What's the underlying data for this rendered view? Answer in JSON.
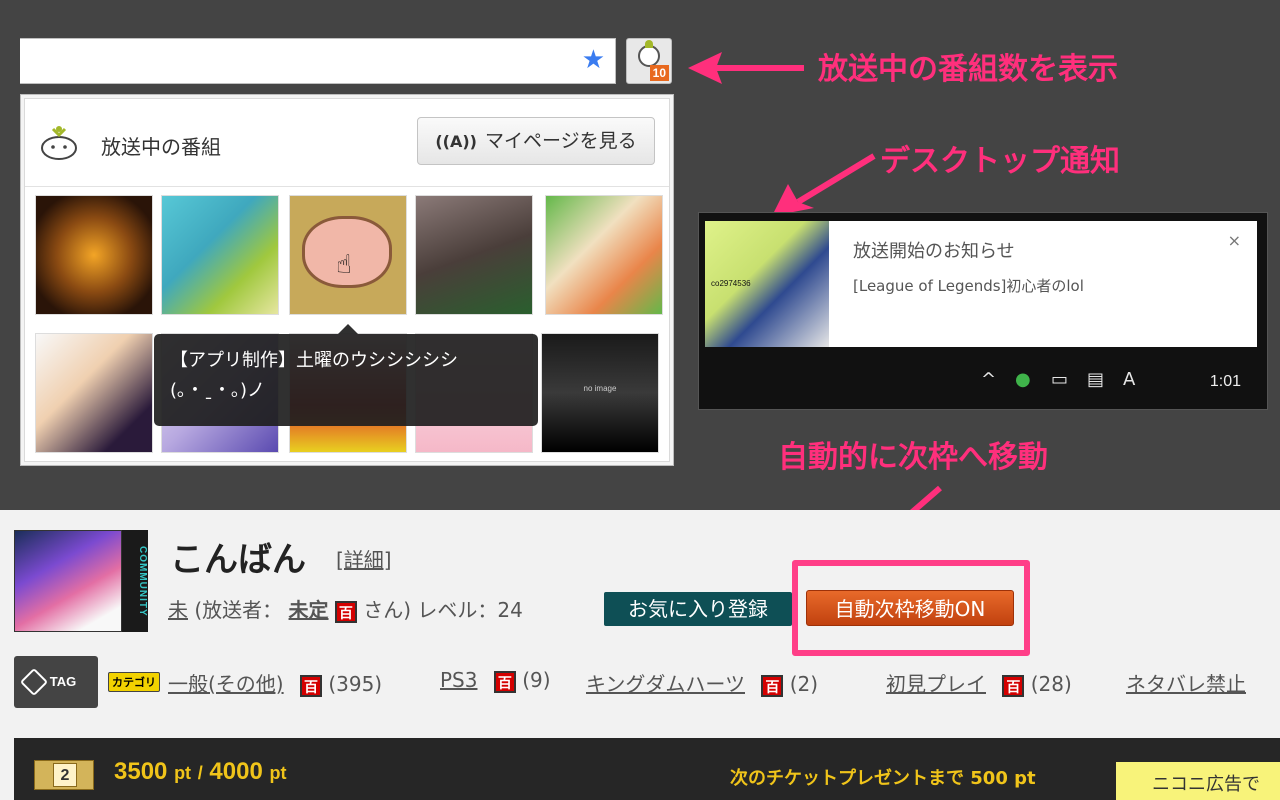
{
  "browser": {
    "extension_badge": "10"
  },
  "callouts": {
    "show_count": "放送中の番組数を表示",
    "desktop_notify": "デスクトップ通知",
    "auto_move": "自動的に次枠へ移動"
  },
  "popup": {
    "title": "放送中の番組",
    "mypage_label": "マイページを見る",
    "tooltip_line1": "【アプリ制作】土曜のウシシシシシ",
    "tooltip_line2": "(｡・ˍ・｡)ノ",
    "no_image_text": "no image"
  },
  "notification": {
    "title": "放送開始のお知らせ",
    "body": "[League of Legends]初心者のlol",
    "community_code": "co2974536",
    "close": "×",
    "clock": "1:01"
  },
  "live": {
    "title": "こんばん",
    "detail_link": "[詳細]",
    "community_label": "COMMUNITY",
    "status": "未",
    "owner_prefix": "(放送者：",
    "owner_name": "未定",
    "owner_suffix": "さん) レベル：24",
    "fav_button": "お気に入り登録",
    "auto_button": "自動次枠移動ON",
    "hyaku": "百"
  },
  "tags": {
    "badge": "TAG",
    "category_badge": "カテゴリ",
    "items": [
      {
        "label": "一般(その他)",
        "count": "(395)"
      },
      {
        "label": "PS3",
        "count": "(9)"
      },
      {
        "label": "キングダムハーツ",
        "count": "(2)"
      },
      {
        "label": "初見プレイ",
        "count": "(28)"
      },
      {
        "label": "ネタバレ禁止",
        "count": ""
      }
    ]
  },
  "points": {
    "level": "2",
    "current": "3500",
    "max": "4000",
    "unit": "pt",
    "separator": "/",
    "next_ticket": "次のチケットプレゼントまで 500 pt",
    "ad": "ニコニ広告で"
  },
  "colors": {
    "accent_pink": "#ff2f7c",
    "badge_orange": "#e8691e",
    "auto_button": "#d4531a",
    "fav_button": "#0e4f55"
  }
}
